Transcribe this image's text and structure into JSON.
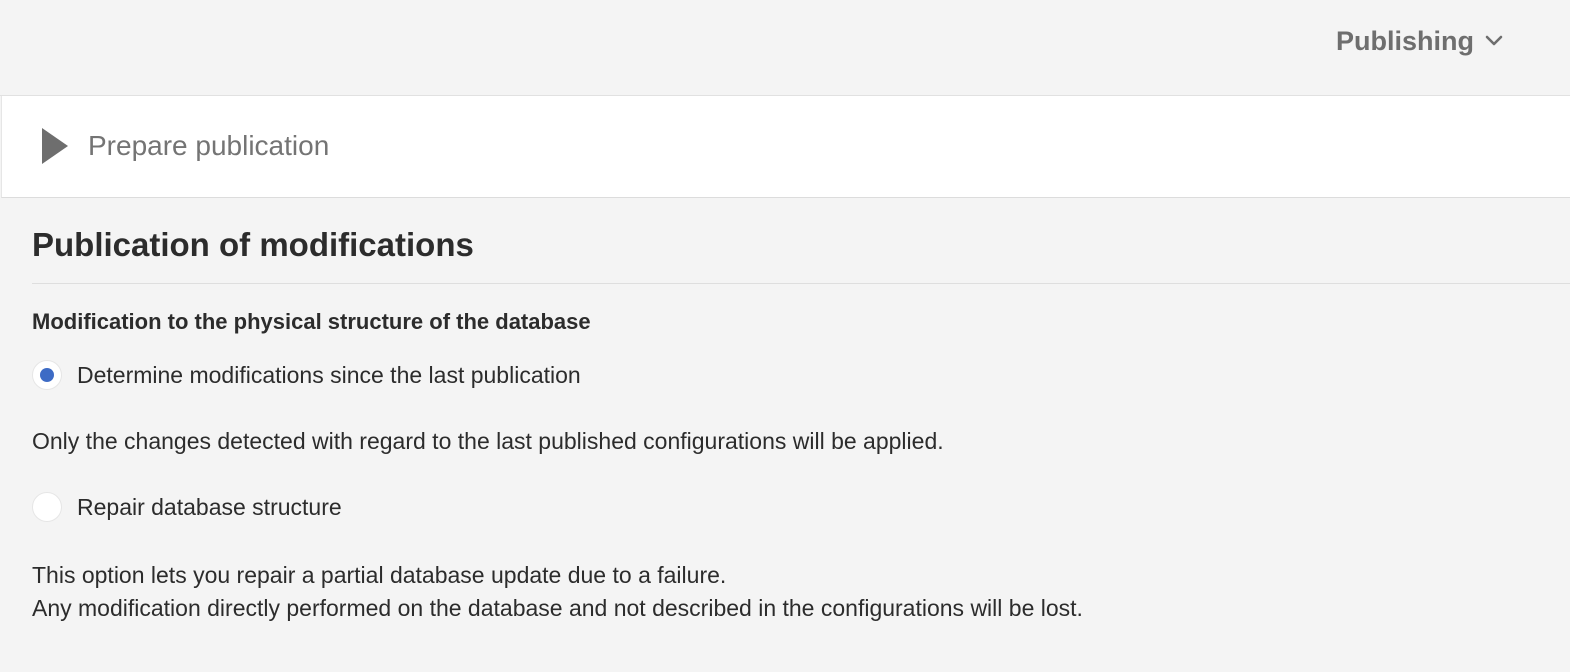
{
  "header": {
    "menu_label": "Publishing",
    "menu_icon": "chevron-down-icon"
  },
  "action_bar": {
    "prepare_label": "Prepare publication",
    "prepare_icon": "play-icon"
  },
  "main": {
    "title": "Publication of modifications",
    "subheading": "Modification to the physical structure of the database",
    "options": [
      {
        "label": "Determine modifications since the last publication",
        "selected": true,
        "description": "Only the changes detected with regard to the last published configurations will be applied."
      },
      {
        "label": "Repair database structure",
        "selected": false,
        "description_line1": "This option lets you repair a partial database update due to a failure.",
        "description_line2": "Any modification directly performed on the database and not described in the configurations will be lost."
      }
    ]
  },
  "colors": {
    "radio_selected": "#3d6bc5",
    "background": "#f4f4f4",
    "panel": "#ffffff"
  }
}
